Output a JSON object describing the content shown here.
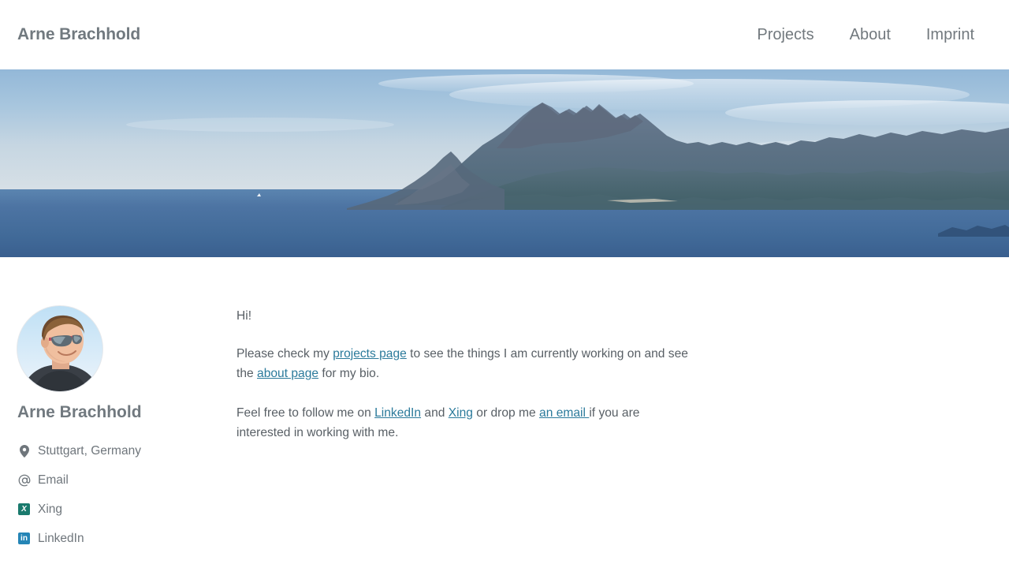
{
  "header": {
    "brand": "Arne Brachhold",
    "nav": [
      {
        "label": "Projects",
        "name": "nav-projects"
      },
      {
        "label": "About",
        "name": "nav-about"
      },
      {
        "label": "Imprint",
        "name": "nav-imprint"
      }
    ]
  },
  "hero": {
    "alt": "Coastal landscape with sea and mountains",
    "colors": {
      "sky_top": "#9cbedb",
      "sky_horizon": "#d5dfe7",
      "sea_top": "#5d86ae",
      "sea_bottom": "#3a5f8f",
      "mountain_far": "#7f93b0",
      "mountain_mid": "#5d7289",
      "mountain_near": "#4b6b74"
    }
  },
  "sidebar": {
    "avatar_alt": "Portrait photo of Arne Brachhold wearing sunglasses",
    "name": "Arne Brachhold",
    "contacts": [
      {
        "label": "Stuttgart, Germany",
        "icon": "map-pin-icon",
        "name": "contact-location"
      },
      {
        "label": "Email",
        "icon": "at-sign-icon",
        "name": "contact-email"
      },
      {
        "label": "Xing",
        "icon": "xing-icon",
        "name": "contact-xing",
        "badge": "X",
        "color": "#1a7a6d"
      },
      {
        "label": "LinkedIn",
        "icon": "linkedin-icon",
        "name": "contact-linkedin",
        "badge": "in",
        "color": "#2585b6"
      }
    ]
  },
  "content": {
    "greeting": "Hi!",
    "para2": {
      "pre": "Please check my ",
      "link1": "projects page",
      "mid": " to see the things I am currently working on and see the ",
      "link2": "about page",
      "post": " for my bio."
    },
    "para3": {
      "pre": "Feel free to follow me on ",
      "link1": "LinkedIn",
      "mid1": " and ",
      "link2": "Xing",
      "mid2": " or drop me ",
      "link3": "an email ",
      "post": "if you are interested in working with me."
    }
  },
  "colors": {
    "link": "#2b7a9b",
    "text": "#585f65",
    "muted": "#6f767c",
    "heading": "#71797f"
  }
}
